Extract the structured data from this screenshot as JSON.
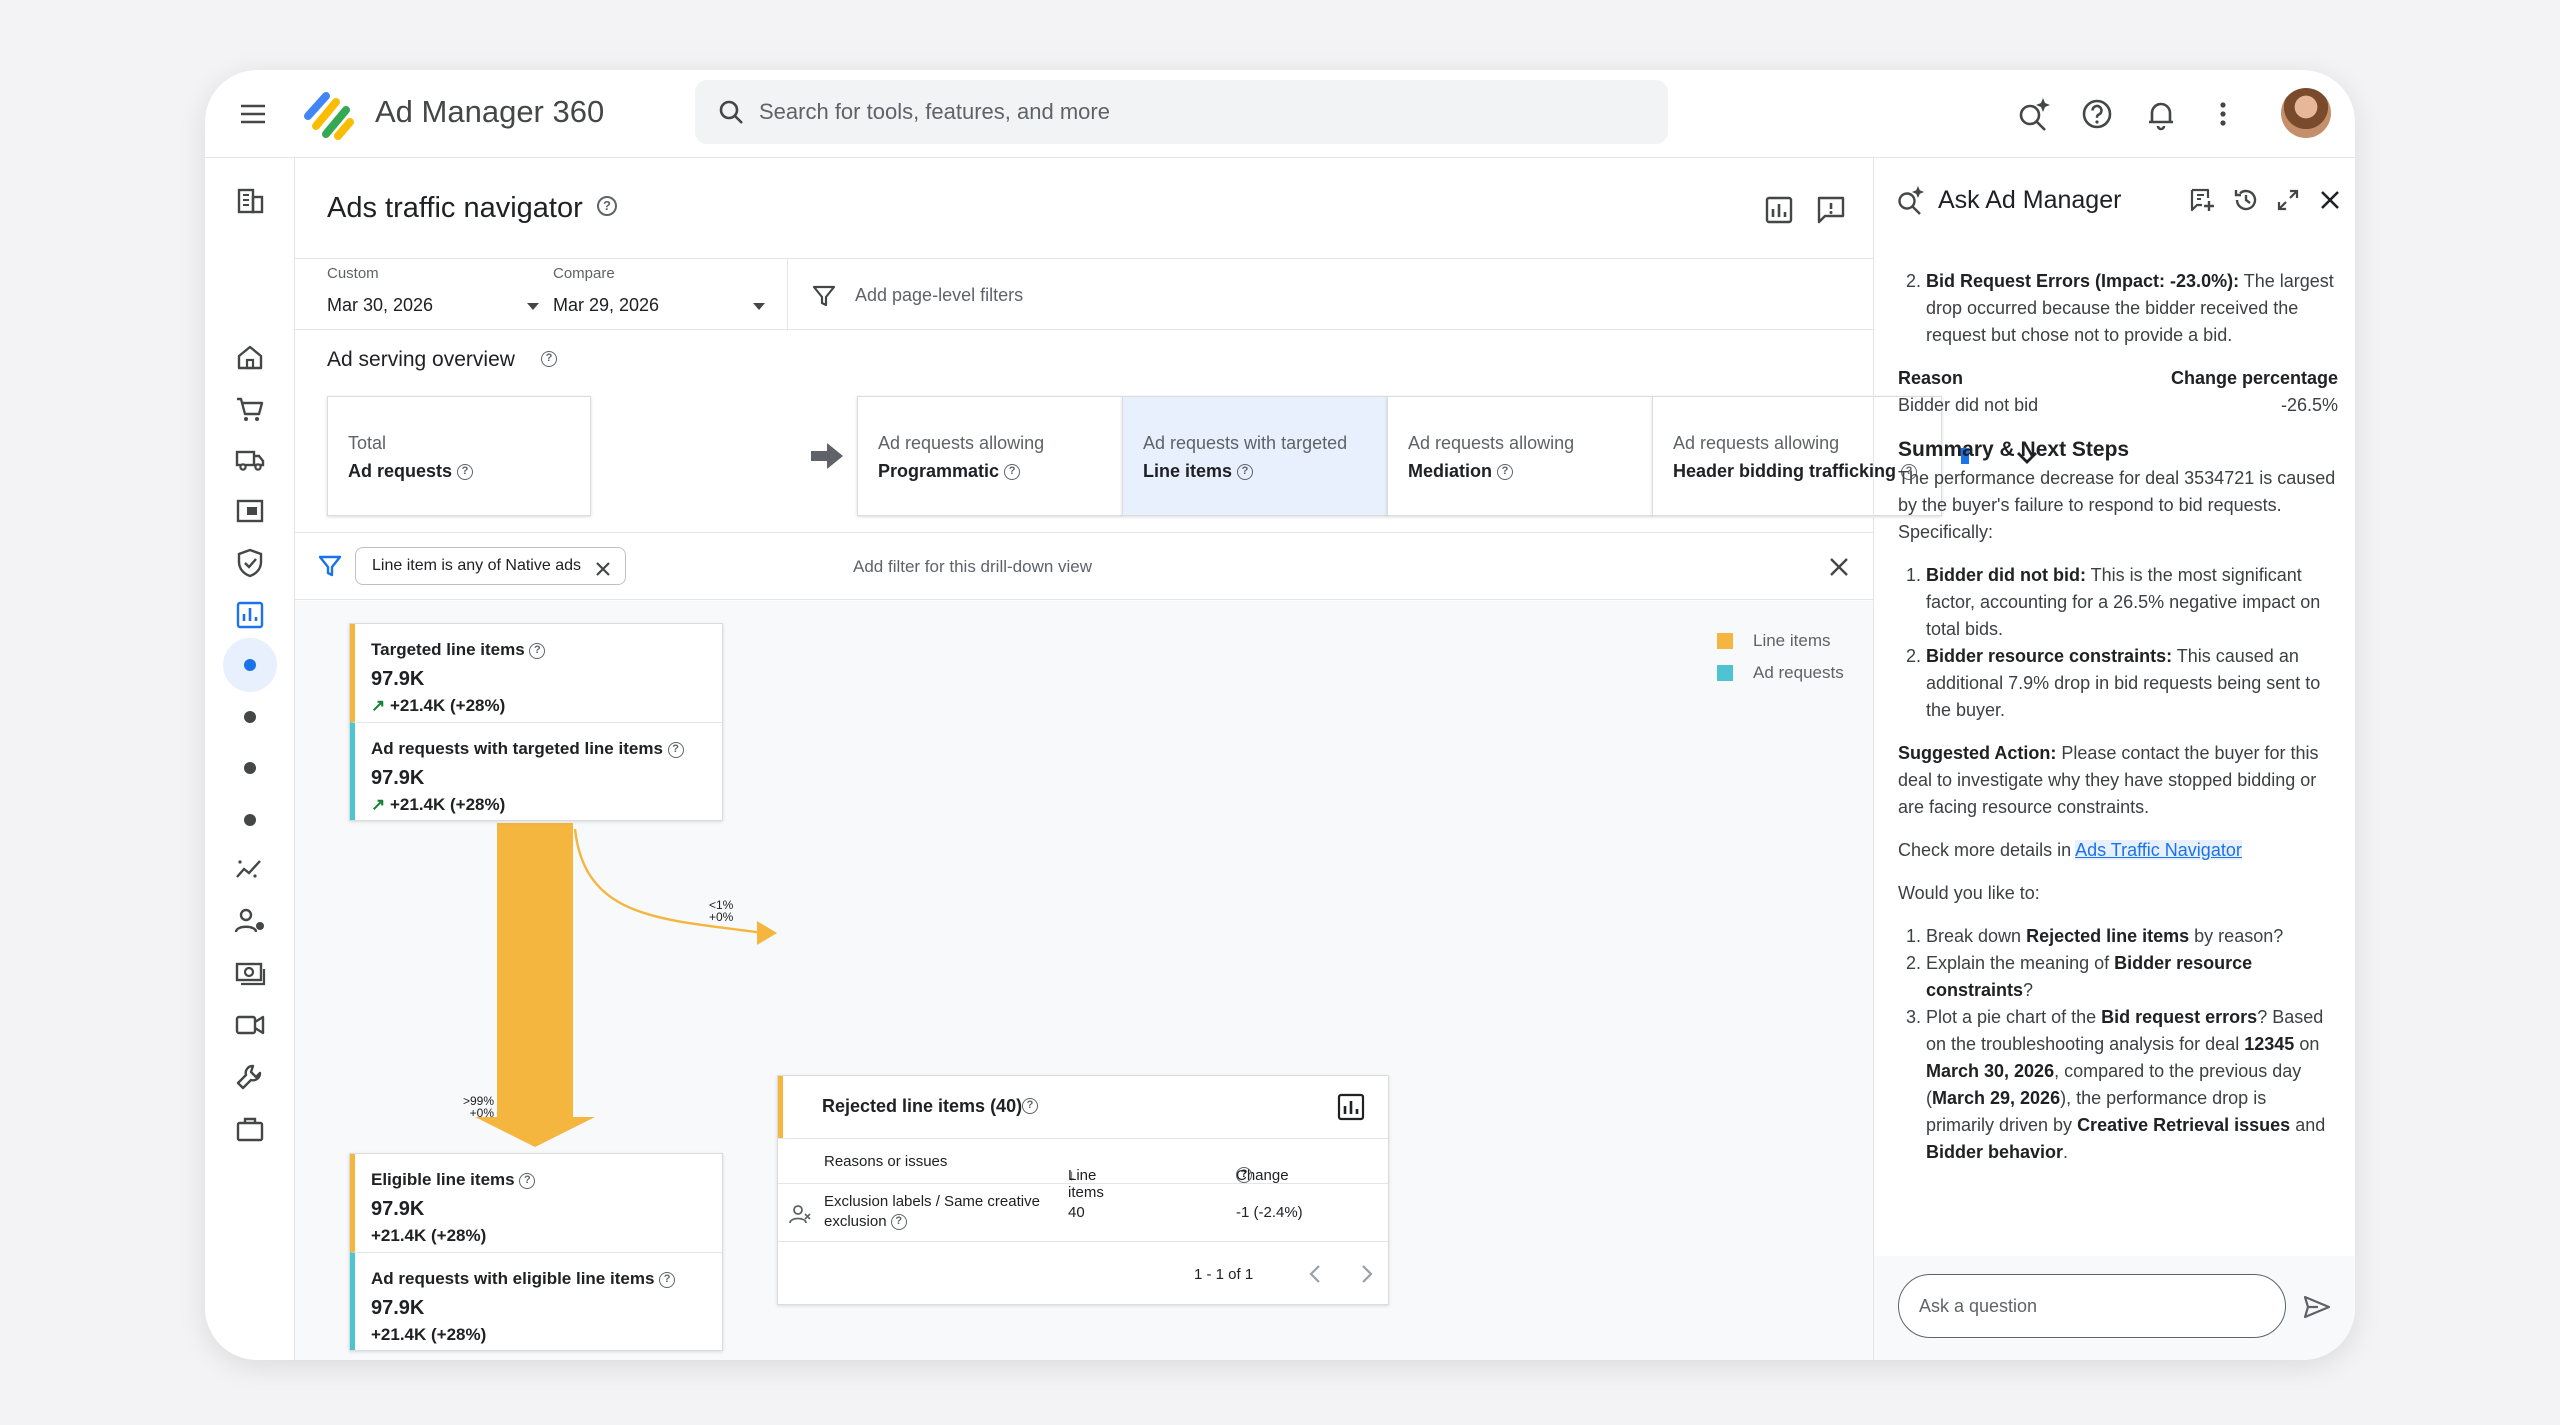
{
  "app": {
    "title": "Ad Manager 360"
  },
  "search": {
    "placeholder": "Search for tools, features, and more"
  },
  "page": {
    "title": "Ads traffic navigator"
  },
  "filters": {
    "custom_label": "Custom",
    "custom_value": "Mar 30, 2026",
    "compare_label": "Compare",
    "compare_value": "Mar 29, 2026",
    "page_filter_placeholder": "Add page-level filters"
  },
  "overview": {
    "title": "Ad serving overview",
    "steps": [
      {
        "line1": "Total",
        "line2": "Ad requests"
      },
      {
        "line1": "Ad requests allowing",
        "line2": "Programmatic"
      },
      {
        "line1": "Ad requests with targeted",
        "line2": "Line items"
      },
      {
        "line1": "Ad requests allowing",
        "line2": "Mediation"
      },
      {
        "line1": "Ad requests allowing",
        "line2": "Header bidding trafficking"
      }
    ]
  },
  "drill": {
    "chip": "Line item is any of Native ads",
    "add_placeholder": "Add filter for this drill-down view"
  },
  "flow": {
    "legend": [
      {
        "label": "Line items",
        "color": "#f4b63f"
      },
      {
        "label": "Ad requests",
        "color": "#4ec4d2"
      }
    ],
    "targeted": {
      "name": "Targeted line items",
      "value": "97.9K",
      "delta": "+21.4K (+28%)"
    },
    "targeted_requests": {
      "name": "Ad requests with targeted line items",
      "value": "97.9K",
      "delta": "+21.4K (+28%)"
    },
    "eligible": {
      "name": "Eligible line items",
      "value": "97.9K",
      "delta": "+21.4K (+28%)"
    },
    "eligible_requests": {
      "name": "Ad requests with eligible line items",
      "value": "97.9K",
      "delta": "+21.4K (+28%)"
    },
    "branch_label_top": "<1%",
    "branch_label_bottom": "+0%",
    "main_label_top": ">99%",
    "main_label_bottom": "+0%"
  },
  "rejected": {
    "title": "Rejected line items (40)",
    "col_reason": "Reasons or issues",
    "col_line_items": "Line items",
    "col_change": "Change",
    "row": {
      "reason": "Exclusion labels / Same creative exclusion",
      "line_items": "40",
      "change": "-1 (-2.4%)"
    },
    "pager": "1 - 1 of 1"
  },
  "assistant": {
    "title": "Ask Ad Manager",
    "item2_title": "Bid Request Errors (Impact: -23.0%):",
    "item2_text": "The largest drop occurred because the bidder received the request but chose not to provide a bid.",
    "table_reason_label": "Reason",
    "table_change_label": "Change percentage",
    "table_reason_value": "Bidder did not bid",
    "table_change_value": "-26.5%",
    "summary_title": "Summary & Next Steps",
    "summary_text": "The performance decrease for deal 3534721 is caused by the buyer's failure to respond to bid requests. Specifically:",
    "s1_title": "Bidder did not bid:",
    "s1_text": "This is the most significant factor, accounting for a 26.5% negative impact on total bids.",
    "s2_title": "Bidder resource constraints:",
    "s2_text": "This caused an additional 7.9% drop in bid requests being sent to the buyer.",
    "suggested_title": "Suggested Action:",
    "suggested_text": "Please contact the buyer for this deal to investigate why they have stopped bidding or are facing resource constraints.",
    "check_text": "Check more details in",
    "check_link": "Ads Traffic Navigator",
    "would_like": "Would you like to:",
    "q1_a": "Break down",
    "q1_b": "Rejected line items",
    "q1_c": "by reason?",
    "q2_a": "Explain the meaning of",
    "q2_b": "Bidder resource constraints",
    "q2_c": "?",
    "q3_a": "Plot a pie chart of the",
    "q3_b": "Bid request errors",
    "q3_c": "?",
    "q3_d": "Based on the troubleshooting analysis for deal",
    "q3_e": "12345",
    "q3_f": "on",
    "q3_g": "March 30, 2026",
    "q3_h": ", compared to the previous day (",
    "q3_i": "March 29, 2026",
    "q3_j": "), the performance drop is primarily driven by",
    "q3_k": "Creative Retrieval issues",
    "q3_l": "and",
    "q3_m": "Bidder behavior",
    "q3_n": ".",
    "ask_placeholder": "Ask a question"
  },
  "colors": {
    "accent": "#1a73e8",
    "line_items": "#f4b63f",
    "ad_requests": "#4ec4d2"
  }
}
